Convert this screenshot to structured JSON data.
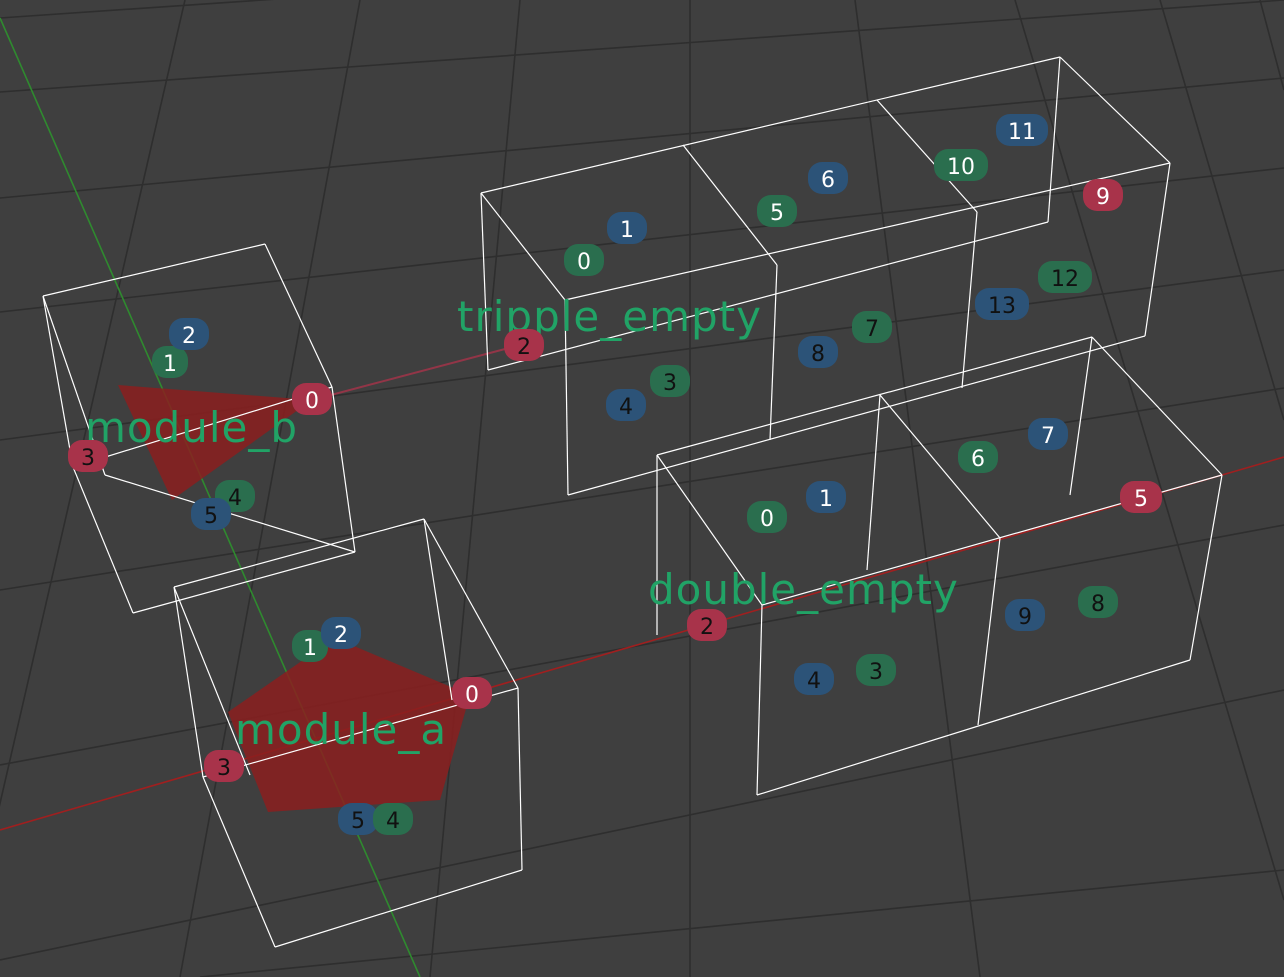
{
  "colors": {
    "background": "#3f3f3f",
    "grid": "#2e2e2e",
    "wireframe": "#ffffff",
    "axis_y": "#2f8a2f",
    "axis_x": "#a01f1f",
    "label": "#21a366",
    "badge_green": "#2a6e4e",
    "badge_blue": "#2c5378",
    "badge_red": "#a8334a",
    "gizmo_fill": "#8b1e1e"
  },
  "modules": {
    "module_b": {
      "label": "module_b",
      "sockets": [
        "0",
        "1",
        "2",
        "3",
        "4",
        "5"
      ]
    },
    "module_a": {
      "label": "module_a",
      "sockets": [
        "0",
        "1",
        "2",
        "3",
        "4",
        "5"
      ]
    },
    "tripple_empty": {
      "label": "tripple_empty",
      "sockets": [
        "0",
        "1",
        "2",
        "3",
        "4",
        "5",
        "6",
        "7",
        "8",
        "9",
        "10",
        "11",
        "12",
        "13"
      ]
    },
    "double_empty": {
      "label": "double_empty",
      "sockets": [
        "0",
        "1",
        "2",
        "3",
        "4",
        "5",
        "6",
        "7",
        "8",
        "9"
      ]
    }
  }
}
